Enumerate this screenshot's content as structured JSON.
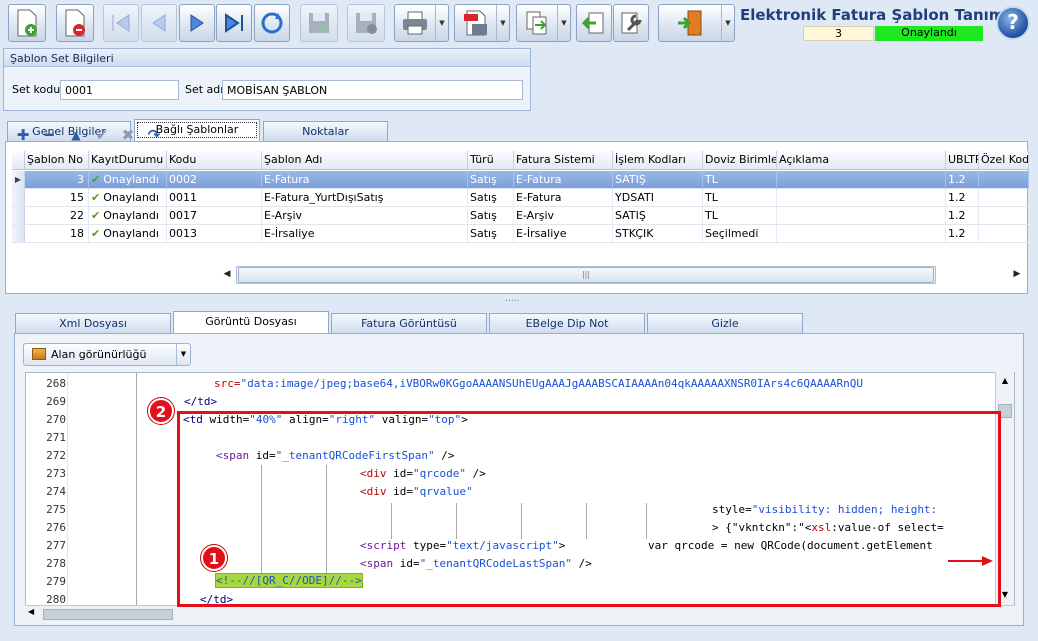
{
  "window": {
    "title": "Elektronik Fatura Şablon Tanımı",
    "record_count": "3",
    "record_status": "Onaylandı"
  },
  "toolbar": {
    "buttons": [
      "new-doc-icon",
      "delete-doc-icon",
      "first-record-icon",
      "previous-record-icon",
      "next-record-icon",
      "last-record-icon",
      "refresh-icon",
      "save-icon",
      "save-cancel-icon",
      "print-icon",
      "pdf-export-icon",
      "copy-icon",
      "back-icon",
      "tools-icon",
      "exit-door-icon",
      "help-icon"
    ]
  },
  "set_group": {
    "title": "Şablon Set Bilgileri",
    "code_label": "Set kodu",
    "code_value": "0001",
    "name_label": "Set adı",
    "name_value": "MOBİSAN ŞABLON"
  },
  "main_tabs": [
    {
      "label": "Genel Bilgiler"
    },
    {
      "label": "Bağlı Şablonlar",
      "active": true
    },
    {
      "label": "Noktalar"
    }
  ],
  "grid": {
    "columns": [
      "Şablon No",
      "KayıtDurumu",
      "Kodu",
      "Şablon Adı",
      "Türü",
      "Fatura Sistemi",
      "İşlem Kodları",
      "Doviz Birimleri",
      "Açıklama",
      "UBLTR",
      "Özel Kod"
    ],
    "rows": [
      {
        "no": "3",
        "status": "Onaylandı",
        "code": "0002",
        "name": "E-Fatura",
        "type": "Satış",
        "system": "E-Fatura",
        "op": "SATIŞ",
        "currency": "TL",
        "desc": "",
        "ubl": "1.2",
        "special": "",
        "selected": true
      },
      {
        "no": "15",
        "status": "Onaylandı",
        "code": "0011",
        "name": "E-Fatura_YurtDışıSatış",
        "type": "Satış",
        "system": "E-Fatura",
        "op": "YDSATI",
        "currency": "TL",
        "desc": "",
        "ubl": "1.2",
        "special": ""
      },
      {
        "no": "22",
        "status": "Onaylandı",
        "code": "0017",
        "name": "E-Arşiv",
        "type": "Satış",
        "system": "E-Arşiv",
        "op": "SATIŞ",
        "currency": "TL",
        "desc": "",
        "ubl": "1.2",
        "special": ""
      },
      {
        "no": "18",
        "status": "Onaylandı",
        "code": "0013",
        "name": "E-İrsaliye",
        "type": "Satış",
        "system": "E-İrsaliye",
        "op": "STKÇIK",
        "currency": "Seçilmedi",
        "desc": "",
        "ubl": "1.2",
        "special": ""
      }
    ],
    "nav_buttons": [
      "add-icon",
      "remove-icon",
      "move-up-icon",
      "confirm-icon",
      "cancel-icon",
      "undo-icon"
    ]
  },
  "splitter": ".....",
  "sub_tabs": [
    {
      "label": "Xml Dosyası"
    },
    {
      "label": "Görüntü Dosyası",
      "active": true
    },
    {
      "label": "Fatura Görüntüsü"
    },
    {
      "label": "EBelge Dip Not"
    },
    {
      "label": "Gizle"
    }
  ],
  "field_visibility_button": "Alan görünürlüğü",
  "code": {
    "line_numbers": [
      "268",
      "269",
      "270",
      "271",
      "272",
      "273",
      "274",
      "275",
      "276",
      "277",
      "278",
      "279",
      "280"
    ],
    "l268_attr": "src=",
    "l268_val": "\"data:image/jpeg;base64,iVBORw0KGgoAAAANSUhEUgAAAJgAAABSCAIAAAAn04qkAAAAAXNSR0IArs4c6QAAAARnQU",
    "l269": "</td>",
    "l270_tag": "<td",
    "l270_a1": " width=",
    "l270_v1": "\"40%\"",
    "l270_a2": " align=",
    "l270_v2": "\"right\"",
    "l270_a3": " valign=",
    "l270_v3": "\"top\"",
    "l270_end": ">",
    "l272_tag": "<span",
    "l272_a": " id=",
    "l272_v": "\"_tenantQRCodeFirstSpan\"",
    "l272_end": " />",
    "l273_tag": "<div",
    "l273_a": " id=",
    "l273_v": "\"qrcode\"",
    "l273_end": " />",
    "l274_tag": "<div",
    "l274_a": " id=",
    "l274_v": "\"qrvalue\"",
    "l275_a": "style=",
    "l275_v": "\"visibility: hidden; height:",
    "l276_pre": "> {\"vkntckn\":\"<",
    "l276_tag": "xsl",
    "l276_rest": ":value-of select=",
    "l277_tag": "<script",
    "l277_a": " type=",
    "l277_v": "\"text/javascript\"",
    "l277_end": ">",
    "l277_js": "var qrcode = new QRCode(document.getElement",
    "l278_tag": "<span",
    "l278_a": " id=",
    "l278_v": "\"_tenantQRCodeLastSpan\"",
    "l278_end": " />",
    "l279_comment": "<!--//[QR_C//ODE]//-->",
    "l280": "</td>"
  },
  "annotations": {
    "badge1": "1",
    "badge2": "2",
    "highlight_color": "#e3101c"
  }
}
